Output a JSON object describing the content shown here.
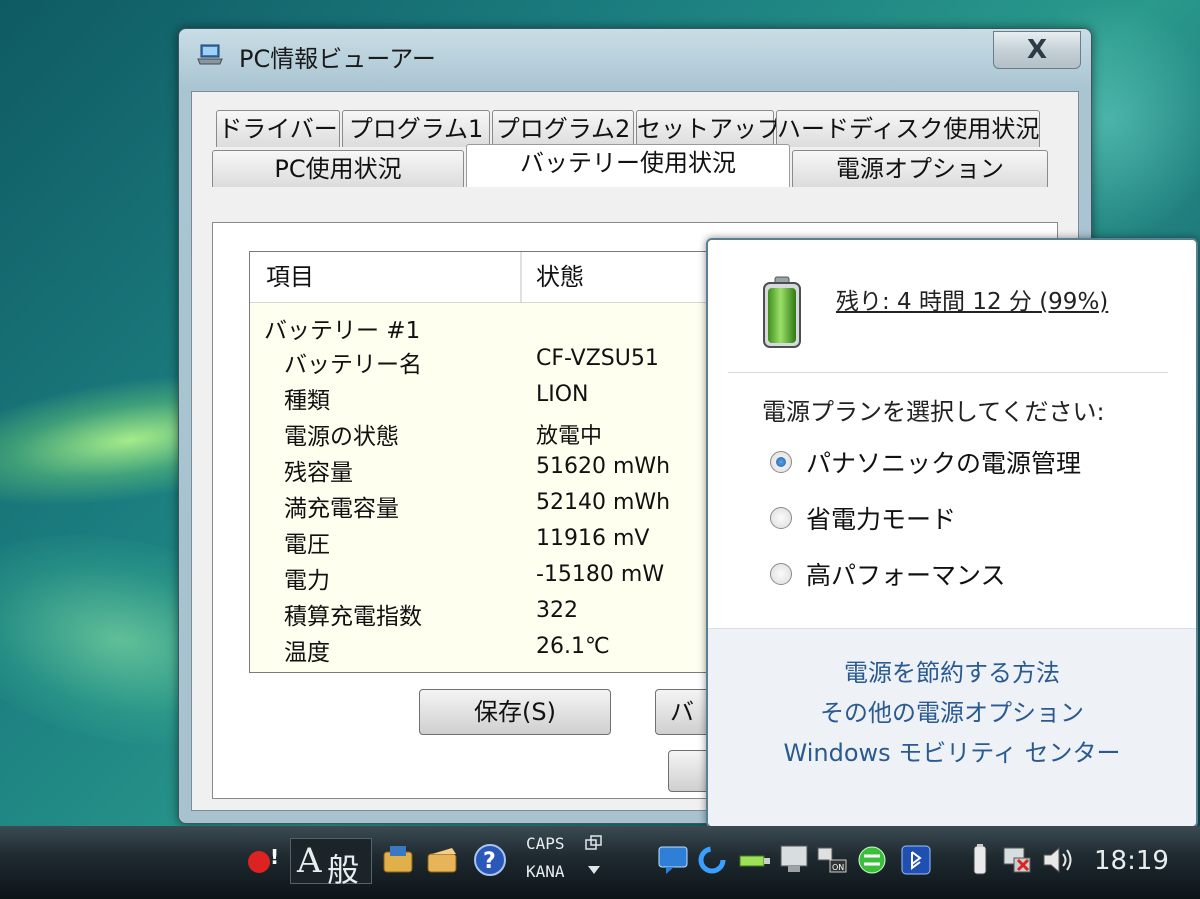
{
  "window": {
    "title": "PC情報ビューアー",
    "close_label": "X"
  },
  "tabs_row1": [
    "ドライバー",
    "プログラム1",
    "プログラム2",
    "セットアップ",
    "ハードディスク使用状況"
  ],
  "tabs_row2": [
    "PC使用状況",
    "バッテリー使用状況",
    "電源オプション"
  ],
  "active_tab": "バッテリー使用状況",
  "listview": {
    "columns": [
      "項目",
      "状態"
    ],
    "group": "バッテリー #1",
    "rows": [
      {
        "label": "バッテリー名",
        "value": "CF-VZSU51"
      },
      {
        "label": "種類",
        "value": "LION"
      },
      {
        "label": "電源の状態",
        "value": "放電中"
      },
      {
        "label": "残容量",
        "value": "51620 mWh"
      },
      {
        "label": "満充電容量",
        "value": "52140 mWh"
      },
      {
        "label": "電圧",
        "value": "11916 mV"
      },
      {
        "label": "電力",
        "value": "-15180 mW"
      },
      {
        "label": "積算充電指数",
        "value": "322"
      },
      {
        "label": "温度",
        "value": "26.1℃"
      }
    ]
  },
  "buttons": {
    "save": "保存(S)",
    "second_partial": "バ"
  },
  "battery_popup": {
    "remaining": "残り: 4 時間 12 分 (99%)",
    "plan_prompt": "電源プランを選択してください:",
    "plans": [
      {
        "label": "パナソニックの電源管理",
        "selected": true
      },
      {
        "label": "省電力モード",
        "selected": false
      },
      {
        "label": "高パフォーマンス",
        "selected": false
      }
    ],
    "links": [
      "電源を節約する方法",
      "その他の電源オプション",
      "Windows モビリティ センター"
    ]
  },
  "taskbar": {
    "ime_mode": "A",
    "ime_dict": "般",
    "caps": "CAPS",
    "kana": "KANA",
    "clock": "18:19"
  },
  "colors": {
    "link": "#2a5a91",
    "battery_green": "#4caf2a",
    "radio_selected": "#1e5fa8"
  }
}
